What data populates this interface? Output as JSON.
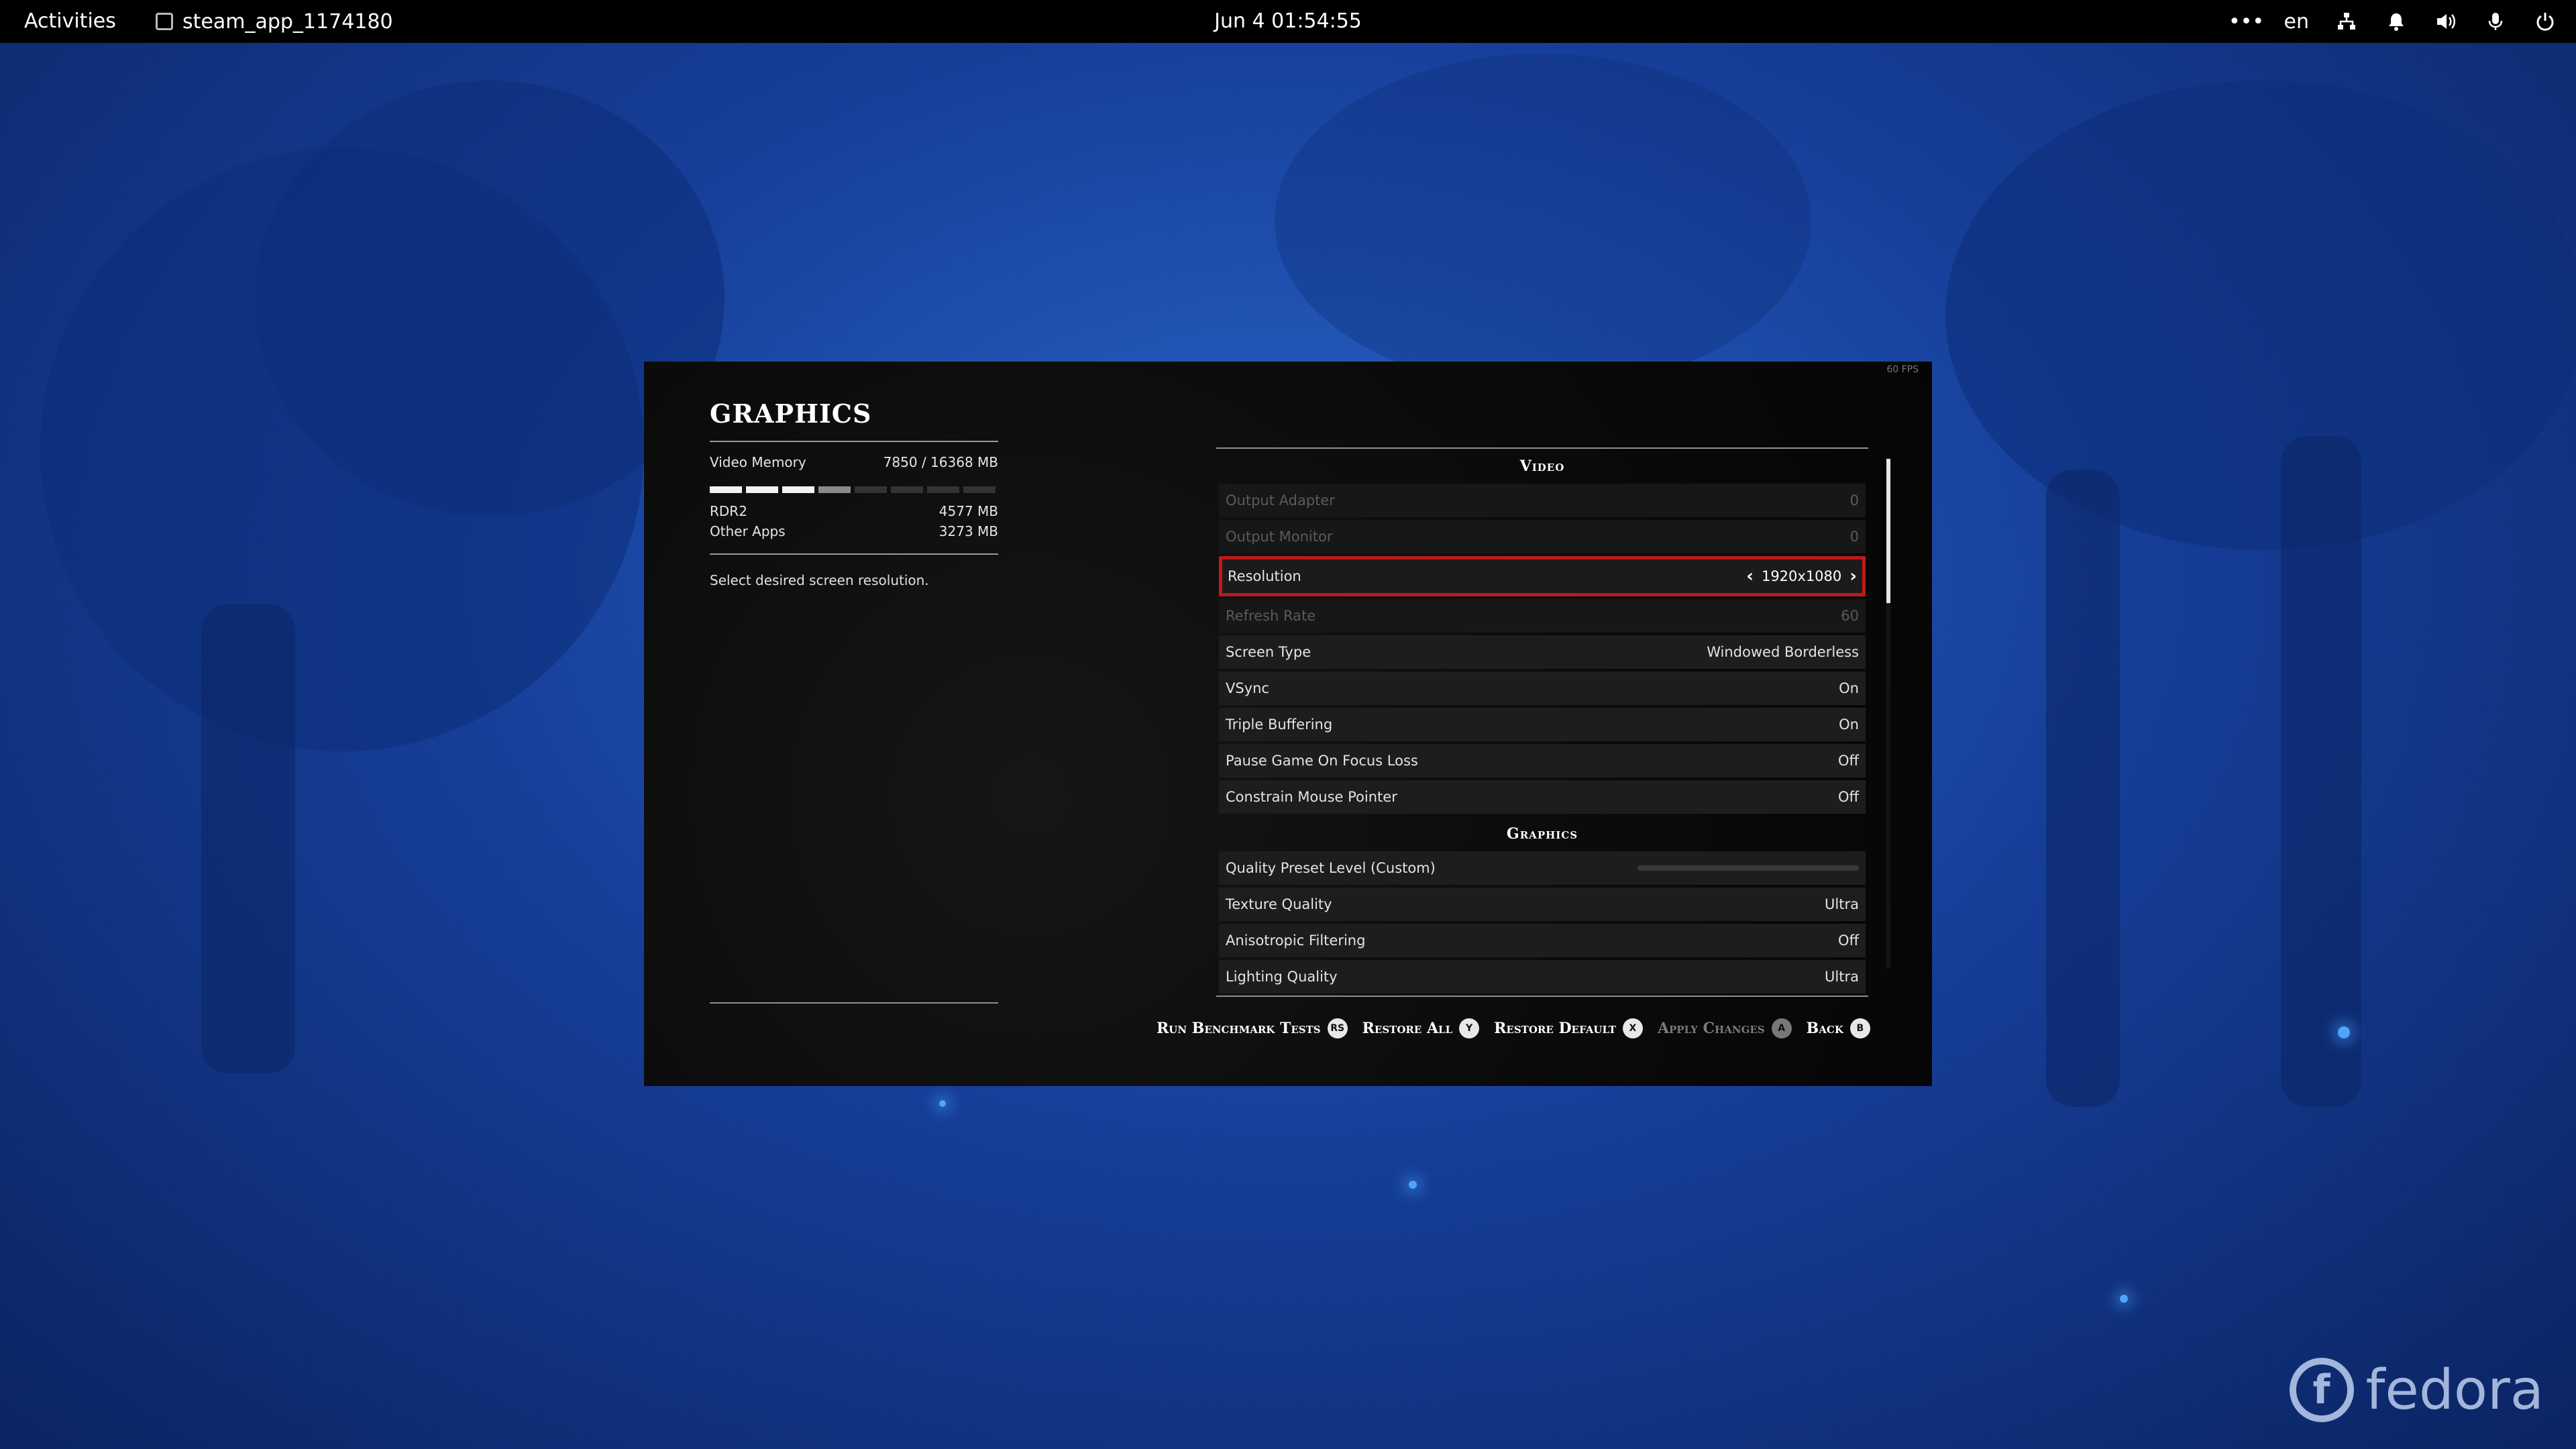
{
  "topbar": {
    "activities": "Activities",
    "app_name": "steam_app_1174180",
    "clock": "Jun 4  01:54:55",
    "language": "en",
    "overflow": "•••"
  },
  "game": {
    "fps": "60 FPS",
    "left": {
      "title": "GRAPHICS",
      "video_memory_label": "Video Memory",
      "video_memory_value": "7850  / 16368  MB",
      "video_memory_usage_fraction": 0.48,
      "apps": [
        {
          "name": "RDR2",
          "value": "4577  MB"
        },
        {
          "name": "Other Apps",
          "value": "3273  MB"
        }
      ],
      "description": "Select desired screen resolution."
    },
    "sections": {
      "video": "Video",
      "graphics": "Graphics"
    },
    "video_rows": [
      {
        "label": "Output Adapter",
        "value": "0"
      },
      {
        "label": "Output Monitor",
        "value": "0"
      },
      {
        "label": "Resolution",
        "value": "1920x1080"
      },
      {
        "label": "Refresh Rate",
        "value": "60"
      },
      {
        "label": "Screen Type",
        "value": "Windowed Borderless"
      },
      {
        "label": "VSync",
        "value": "On"
      },
      {
        "label": "Triple Buffering",
        "value": "On"
      },
      {
        "label": "Pause Game On Focus Loss",
        "value": "Off"
      },
      {
        "label": "Constrain Mouse Pointer",
        "value": "Off"
      }
    ],
    "graphics_rows": [
      {
        "label": "Quality Preset Level (Custom)",
        "value": ""
      },
      {
        "label": "Texture Quality",
        "value": "Ultra"
      },
      {
        "label": "Anisotropic Filtering",
        "value": "Off"
      },
      {
        "label": "Lighting Quality",
        "value": "Ultra"
      }
    ],
    "actions": [
      {
        "label": "Run Benchmark Tests",
        "key": "RS"
      },
      {
        "label": "Restore All",
        "key": "Y"
      },
      {
        "label": "Restore Default",
        "key": "X"
      },
      {
        "label": "Apply Changes",
        "key": "A"
      },
      {
        "label": "Back",
        "key": "B"
      }
    ]
  },
  "desktop": {
    "logo_text": "fedora",
    "logo_mark": "f"
  }
}
